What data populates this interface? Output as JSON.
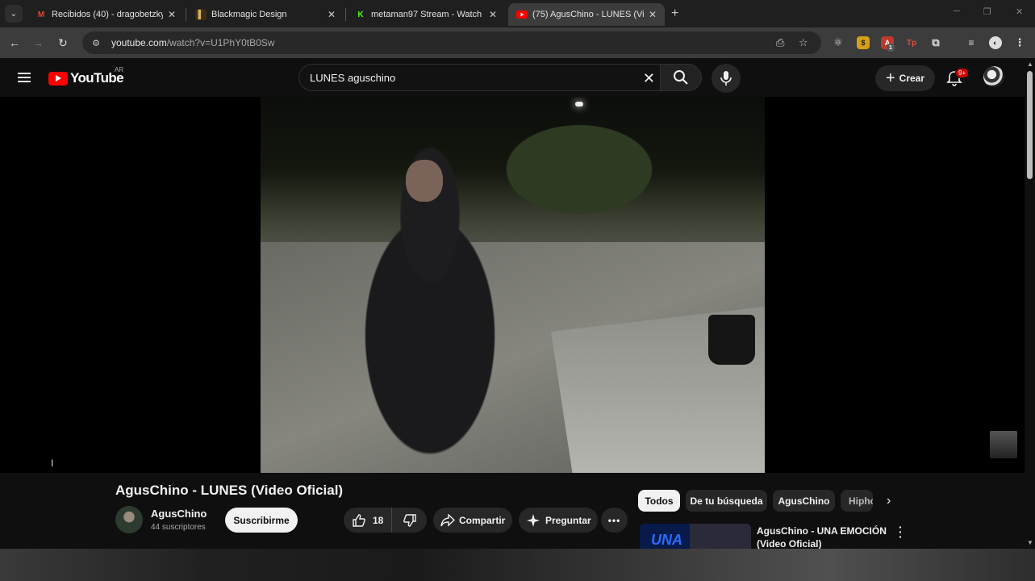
{
  "browser": {
    "tabs": [
      {
        "title": "Recibidos (40) - dragobetzkyda",
        "icon": "gmail-icon",
        "color": "#ea4335"
      },
      {
        "title": "Blackmagic Design",
        "icon": "blackmagic-icon",
        "color": "#b08a3a"
      },
      {
        "title": "metaman97 Stream - Watch Liv",
        "icon": "kick-icon",
        "color": "#53fc18"
      },
      {
        "title": "(75) AgusChino - LUNES (Video",
        "icon": "youtube-icon",
        "color": "#ff0000"
      }
    ],
    "url_host": "youtube.com",
    "url_path": "/watch?v=U1PhY0tB0Sw",
    "ext_badge": "1"
  },
  "youtube": {
    "logo_text": "YouTube",
    "country": "AR",
    "search_query": "LUNES aguschino",
    "create_label": "Crear",
    "notif_count": "9+",
    "accent": "#ff0000"
  },
  "video": {
    "title": "AgusChino - LUNES (Video Oficial)",
    "channel": "AgusChino",
    "subscribers": "44 suscriptores",
    "subscribe_label": "Suscribirme",
    "likes": "18",
    "share_label": "Compartir",
    "ask_label": "Preguntar",
    "more_label": "•••"
  },
  "chips": [
    "Todos",
    "De tu búsqueda",
    "AgusChino",
    "Hiphop"
  ],
  "recommended": [
    {
      "title": "AgusChino - UNA EMOCIÓN (Video Oficial)",
      "thumb_text": "UNA"
    }
  ]
}
